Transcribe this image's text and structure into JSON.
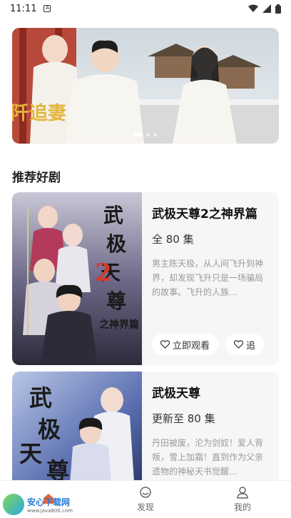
{
  "status_bar": {
    "time": "11:11",
    "notification": "A"
  },
  "banner": {
    "caption": "阡追妻"
  },
  "section": {
    "title": "推荐好剧"
  },
  "dramas": [
    {
      "title": "武极天尊2之神界篇",
      "episodes": "全 80 集",
      "description": "男主陈天极，从人间飞升到神界，却发现飞升只是一场骗局的故事。飞升的人族…",
      "watch_label": "立即观看",
      "follow_label": "追",
      "poster_text": "武极天尊",
      "poster_sub": "2之神界篇"
    },
    {
      "title": "武极天尊",
      "episodes": "更新至 80 集",
      "description": "丹田被废，沦为剑奴！爱人背叛，雪上加霜！直到作为父亲遗物的神秘天书觉醒…",
      "poster_text": "武极天尊"
    }
  ],
  "tabbar": {
    "home_label": "",
    "discover_label": "发现",
    "mine_label": "我的"
  },
  "watermark": {
    "title": "安心下载网",
    "url": "www.java800.com"
  },
  "colors": {
    "accent": "#e8623a",
    "card_bg": "#f6f6f8"
  }
}
